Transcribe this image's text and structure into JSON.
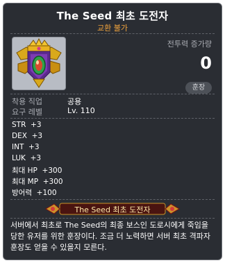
{
  "item": {
    "name": "The Seed 최초 도전자",
    "trade_status": "교환 불가",
    "icon_name": "medal-icon"
  },
  "power": {
    "label": "전투력 증가량",
    "value": "0"
  },
  "badge_label": "훈장",
  "requirements": [
    {
      "label": "착용 직업",
      "value": "공용"
    },
    {
      "label": "요구 레벨",
      "value": "Lv. 110"
    }
  ],
  "stats": [
    "STR  +3",
    "DEX  +3",
    "INT  +3",
    "LUK  +3",
    "최대 HP  +300",
    "최대 MP  +300",
    "방어력  +100"
  ],
  "medal_banner": "The Seed 최초 도전자",
  "description": "서버에서 최초로 The Seed의 최종 보스인 도로시에게 죽임을 당한 유저를 위한 훈장이다. 조금 더 노력하면 서버 최초 격파자 훈장도 얻을 수 있을지 모른다.",
  "colors": {
    "background": "#2a2d33",
    "border": "#6f7278",
    "subtitle": "#f0a33c",
    "label": "#a9acb3"
  }
}
